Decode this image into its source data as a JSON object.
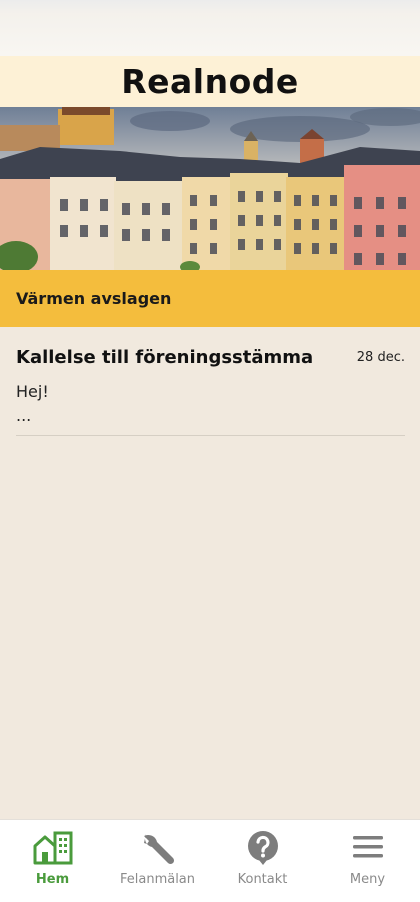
{
  "header": {
    "title": "Realnode"
  },
  "alert": {
    "text": "Värmen avslagen"
  },
  "news": [
    {
      "title": "Kallelse till föreningsstämma",
      "date": "28 dec.",
      "excerpt": "Hej!\n..."
    }
  ],
  "bottom_nav": {
    "items": [
      {
        "label": "Hem",
        "icon": "home-building-icon",
        "active": true
      },
      {
        "label": "Felanmälan",
        "icon": "wrench-icon",
        "active": false
      },
      {
        "label": "Kontakt",
        "icon": "help-circle-icon",
        "active": false
      },
      {
        "label": "Meny",
        "icon": "hamburger-menu-icon",
        "active": false
      }
    ]
  },
  "colors": {
    "header_bg": "#fdf1d6",
    "alert_bg": "#f4bd3d",
    "page_bg": "#f1e9de",
    "active_nav": "#4a9b3c",
    "inactive_nav": "#8a8a8a"
  }
}
